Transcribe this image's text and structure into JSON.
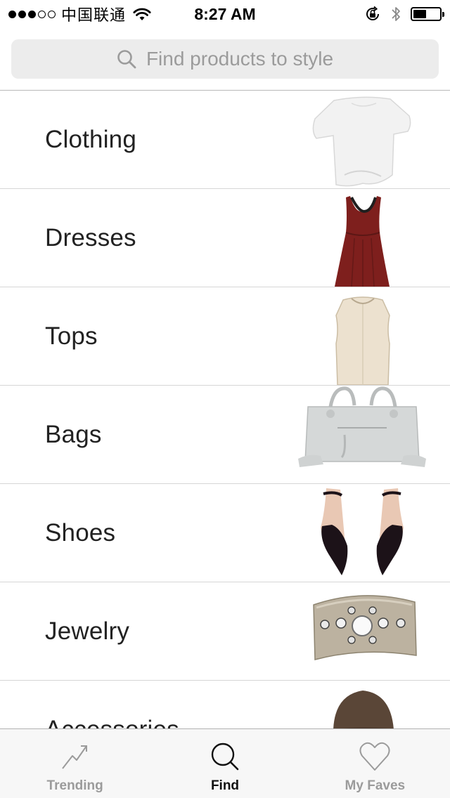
{
  "status_bar": {
    "carrier": "中国联通",
    "time": "8:27 AM",
    "signal_bars_filled": 3,
    "signal_bars_total": 5,
    "battery_level": 0.5
  },
  "search": {
    "placeholder": "Find products to style",
    "icon": "search-icon"
  },
  "categories": [
    {
      "label": "Clothing",
      "thumb": "white-top"
    },
    {
      "label": "Dresses",
      "thumb": "red-dress"
    },
    {
      "label": "Tops",
      "thumb": "beige-sleeveless-top"
    },
    {
      "label": "Bags",
      "thumb": "grey-handbag"
    },
    {
      "label": "Shoes",
      "thumb": "black-pointed-flats"
    },
    {
      "label": "Jewelry",
      "thumb": "jeweled-cuff-bracelet"
    },
    {
      "label": "Accessories",
      "thumb": "brown-hat"
    }
  ],
  "tab_bar": {
    "tabs": [
      {
        "label": "Trending",
        "icon": "trending-icon",
        "active": false
      },
      {
        "label": "Find",
        "icon": "search-icon",
        "active": true
      },
      {
        "label": "My Faves",
        "icon": "heart-icon",
        "active": false
      }
    ]
  },
  "colors": {
    "tab_active": "#111111",
    "tab_inactive": "#9b9b9b",
    "search_bg": "#ececec",
    "placeholder": "#9b9b9b",
    "dress_red": "#7e1f1d"
  }
}
